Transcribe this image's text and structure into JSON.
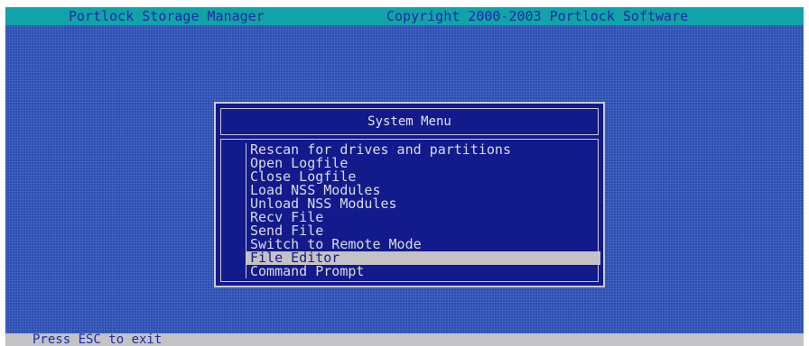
{
  "header": {
    "app_title": "Portlock Storage Manager",
    "copyright": "Copyright 2000-2003 Portlock Software"
  },
  "dialog": {
    "title": "System Menu",
    "items": [
      {
        "label": "Rescan for drives and partitions"
      },
      {
        "label": "Open Logfile"
      },
      {
        "label": "Close Logfile"
      },
      {
        "label": "Load NSS Modules"
      },
      {
        "label": "Unload NSS Modules"
      },
      {
        "label": "Recv File"
      },
      {
        "label": "Send File"
      },
      {
        "label": "Switch to Remote Mode"
      },
      {
        "label": "File Editor"
      },
      {
        "label": "Command Prompt"
      }
    ],
    "selected_item": "File Editor"
  },
  "status": {
    "text": "Press ESC to exit"
  },
  "colors": {
    "title_bar": "#12a3a8",
    "desktop": "#2a4aa8",
    "dialog_bg": "#121a8c",
    "selection": "#c3c3c6",
    "status_bar": "#c3c3c6"
  }
}
